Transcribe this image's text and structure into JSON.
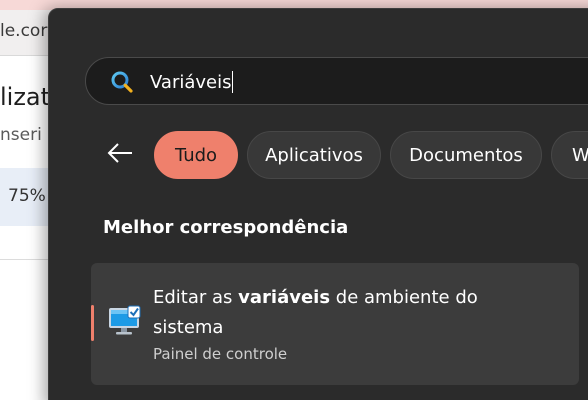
{
  "background_window": {
    "url_fragment": "le.cor",
    "heading_fragment": "lizat",
    "subtext_fragment": "nseri",
    "zoom_fragment": "75%"
  },
  "search": {
    "query": "Variáveis",
    "icon": "search-icon"
  },
  "back": {
    "icon": "arrow-left-icon"
  },
  "filters": {
    "tabs": [
      {
        "label": "Tudo",
        "active": true
      },
      {
        "label": "Aplicativos",
        "active": false
      },
      {
        "label": "Documentos",
        "active": false
      },
      {
        "label": "We",
        "active": false
      }
    ]
  },
  "best_match": {
    "section_title": "Melhor correspondência",
    "result": {
      "title_before": "Editar as ",
      "title_bold": "variáveis",
      "title_after": " de ambiente do sistema",
      "subtitle": "Painel de controle",
      "icon": "monitor-settings-icon"
    }
  },
  "colors": {
    "accent": "#ef806c",
    "panel_bg": "#2b2b2b",
    "card_bg": "#3c3c3c"
  }
}
